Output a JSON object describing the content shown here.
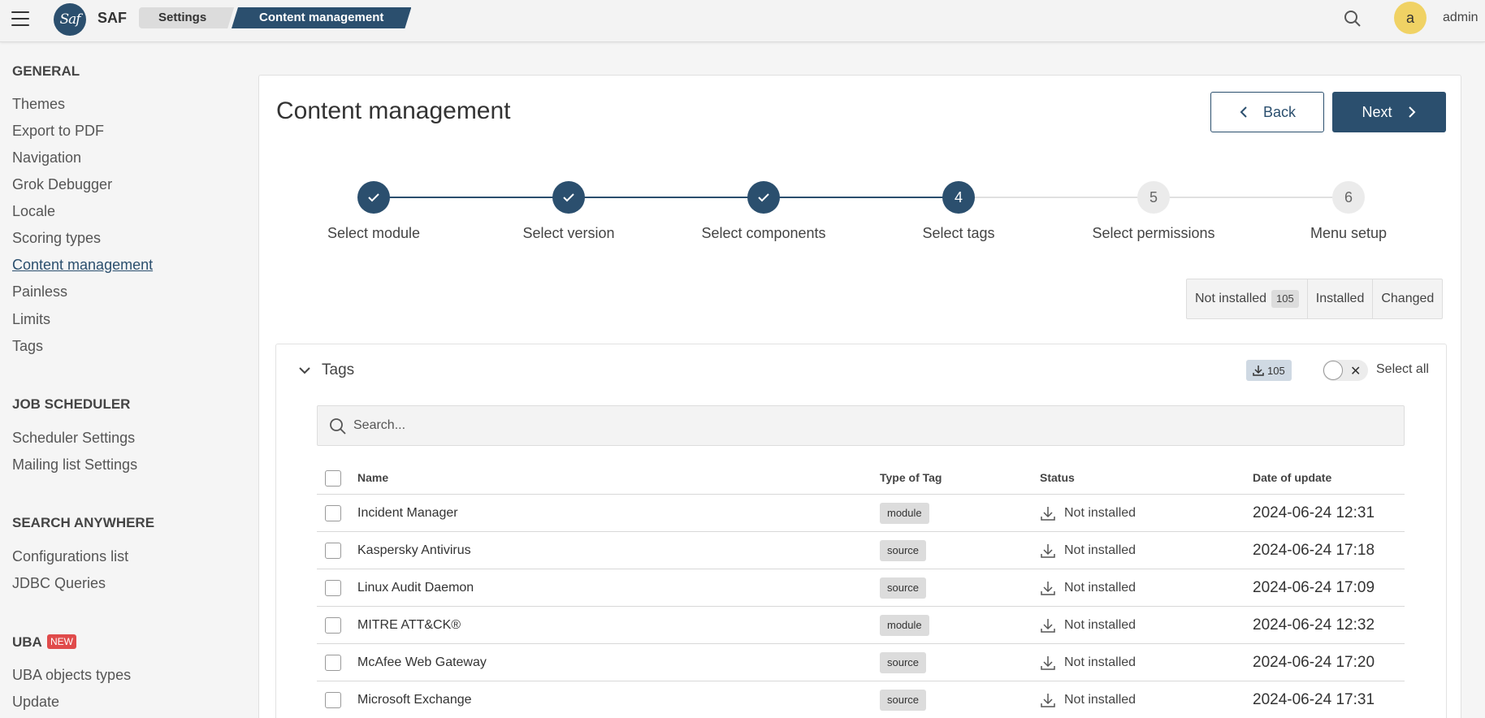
{
  "app": {
    "name": "SAF",
    "logo_text": "Saf"
  },
  "breadcrumb": [
    "Settings",
    "Content management"
  ],
  "user": {
    "initial": "a",
    "name": "admin"
  },
  "sidebar": {
    "sections": [
      {
        "title": "GENERAL",
        "items": [
          "Themes",
          "Export to PDF",
          "Navigation",
          "Grok Debugger",
          "Locale",
          "Scoring types",
          "Content management",
          "Painless",
          "Limits",
          "Tags"
        ]
      },
      {
        "title": "JOB SCHEDULER",
        "items": [
          "Scheduler Settings",
          "Mailing list Settings"
        ]
      },
      {
        "title": "SEARCH ANYWHERE",
        "items": [
          "Configurations list",
          "JDBC Queries"
        ]
      },
      {
        "title": "UBA",
        "badge": "NEW",
        "items": [
          "UBA objects types",
          "Update"
        ]
      }
    ],
    "active_item": "Content management"
  },
  "page": {
    "title": "Content management",
    "back_label": "Back",
    "next_label": "Next"
  },
  "stepper": {
    "steps": [
      {
        "number": "1",
        "label": "Select module",
        "state": "done"
      },
      {
        "number": "2",
        "label": "Select version",
        "state": "done"
      },
      {
        "number": "3",
        "label": "Select components",
        "state": "done"
      },
      {
        "number": "4",
        "label": "Select tags",
        "state": "current"
      },
      {
        "number": "5",
        "label": "Select permissions",
        "state": "todo"
      },
      {
        "number": "6",
        "label": "Menu setup",
        "state": "todo"
      }
    ]
  },
  "filters": {
    "not_installed_label": "Not installed",
    "not_installed_count": "105",
    "installed_label": "Installed",
    "changed_label": "Changed"
  },
  "tags_panel": {
    "title": "Tags",
    "download_count": "105",
    "select_all_label": "Select all",
    "search_placeholder": "Search..."
  },
  "table": {
    "columns": [
      "Name",
      "Type of Tag",
      "Status",
      "Date of update"
    ],
    "rows": [
      {
        "name": "Incident Manager",
        "type": "module",
        "status": "Not installed",
        "date": "2024-06-24 12:31"
      },
      {
        "name": "Kaspersky Antivirus",
        "type": "source",
        "status": "Not installed",
        "date": "2024-06-24 17:18"
      },
      {
        "name": "Linux Audit Daemon",
        "type": "source",
        "status": "Not installed",
        "date": "2024-06-24 17:09"
      },
      {
        "name": "MITRE ATT&CK®",
        "type": "module",
        "status": "Not installed",
        "date": "2024-06-24 12:32"
      },
      {
        "name": "McAfee Web Gateway",
        "type": "source",
        "status": "Not installed",
        "date": "2024-06-24 17:20"
      },
      {
        "name": "Microsoft Exchange",
        "type": "source",
        "status": "Not installed",
        "date": "2024-06-24 17:31"
      }
    ]
  },
  "colors": {
    "primary": "#2b4f6e",
    "avatar": "#f0d264",
    "new_badge": "#e04b4b"
  }
}
